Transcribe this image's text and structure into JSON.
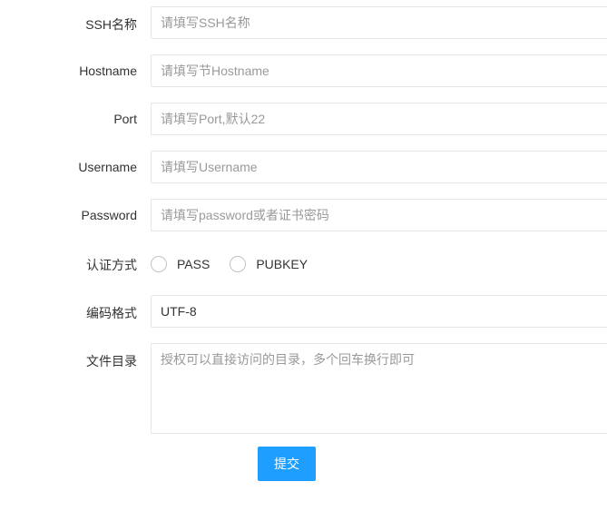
{
  "form": {
    "ssh_name": {
      "label": "SSH名称",
      "placeholder": "请填写SSH名称",
      "value": ""
    },
    "hostname": {
      "label": "Hostname",
      "placeholder": "请填写节Hostname",
      "value": ""
    },
    "port": {
      "label": "Port",
      "placeholder": "请填写Port,默认22",
      "value": ""
    },
    "username": {
      "label": "Username",
      "placeholder": "请填写Username",
      "value": ""
    },
    "password": {
      "label": "Password",
      "placeholder": "请填写password或者证书密码",
      "value": ""
    },
    "auth_method": {
      "label": "认证方式",
      "options": [
        "PASS",
        "PUBKEY"
      ],
      "selected": null
    },
    "encoding": {
      "label": "编码格式",
      "placeholder": "",
      "value": "UTF-8"
    },
    "file_dirs": {
      "label": "文件目录",
      "placeholder": "授权可以直接访问的目录，多个回车换行即可",
      "value": ""
    },
    "submit_label": "提交"
  },
  "colors": {
    "primary": "#1e9fff",
    "border": "#e6e6e6",
    "placeholder": "#999999",
    "text": "#333333"
  }
}
